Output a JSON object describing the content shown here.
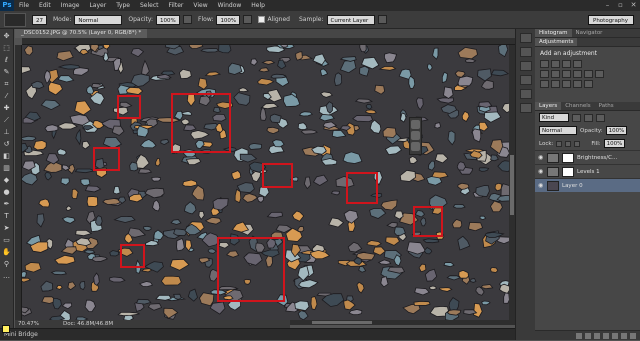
{
  "app": {
    "logo": "Ps"
  },
  "menu": [
    "File",
    "Edit",
    "Image",
    "Layer",
    "Type",
    "Select",
    "Filter",
    "View",
    "Window",
    "Help"
  ],
  "window_controls": {
    "minimize": "–",
    "restore": "▫",
    "close": "✕"
  },
  "options_bar": {
    "brush_size": "27",
    "mode_label": "Mode:",
    "mode_value": "Normal",
    "opacity_label": "Opacity:",
    "opacity_value": "100%",
    "flow_label": "Flow:",
    "flow_value": "100%",
    "aligned_label": "Aligned",
    "sample_label": "Sample:",
    "sample_value": "Current Layer",
    "workspace": "Photography"
  },
  "document_tab": "_DSC0152.JPG @ 70.5% (Layer 0, RGB/8*) *",
  "status": {
    "zoom": "70.47%",
    "doc": "Doc: 46.8M/46.8M"
  },
  "mini_bridge": "Mini Bridge",
  "panels": {
    "top_tabs": [
      "Histogram",
      "Navigator"
    ],
    "adj_tabs": [
      "Adjustments"
    ],
    "adj_title": "Add an adjustment",
    "layer_tabs": [
      "Layers",
      "Channels",
      "Paths"
    ],
    "kind_label": "Kind",
    "blend_mode": "Normal",
    "opacity_label": "Opacity:",
    "opacity_value": "100%",
    "lock_label": "Lock:",
    "fill_label": "Fill:",
    "fill_value": "100%",
    "layers": [
      {
        "name": "Brightness/C...",
        "type": "adjustment"
      },
      {
        "name": "Levels 1",
        "type": "adjustment"
      },
      {
        "name": "Layer 0",
        "type": "image",
        "selected": true
      }
    ]
  },
  "colors": {
    "foreground": "#ffef60",
    "background": "#ffffff",
    "highlight_box": "#d0141c"
  }
}
